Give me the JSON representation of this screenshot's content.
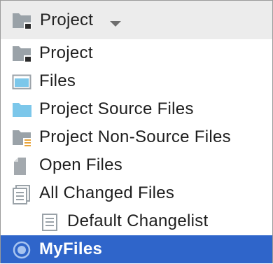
{
  "header": {
    "title": "Project",
    "icon": "project-folder-icon",
    "dropdown_icon": "chevron-down-icon"
  },
  "items": [
    {
      "label": "Project",
      "icon": "project-folder-icon",
      "selected": false
    },
    {
      "label": "Files",
      "icon": "window-icon",
      "selected": false
    },
    {
      "label": "Project Source Files",
      "icon": "folder-icon",
      "selected": false
    },
    {
      "label": "Project Non-Source Files",
      "icon": "folder-files-icon",
      "selected": false
    },
    {
      "label": "Open Files",
      "icon": "file-icon",
      "selected": false
    },
    {
      "label": "All Changed Files",
      "icon": "changelist-stack-icon",
      "selected": false
    },
    {
      "label": "Default Changelist",
      "icon": "changelist-icon",
      "selected": false
    },
    {
      "label": "MyFiles",
      "icon": "radio-scope-icon",
      "selected": true
    }
  ],
  "colors": {
    "header_bg": "#ececec",
    "selection": "#2f65ca",
    "folder_gray": "#9aa2a8",
    "folder_blue": "#7cc7ea"
  }
}
